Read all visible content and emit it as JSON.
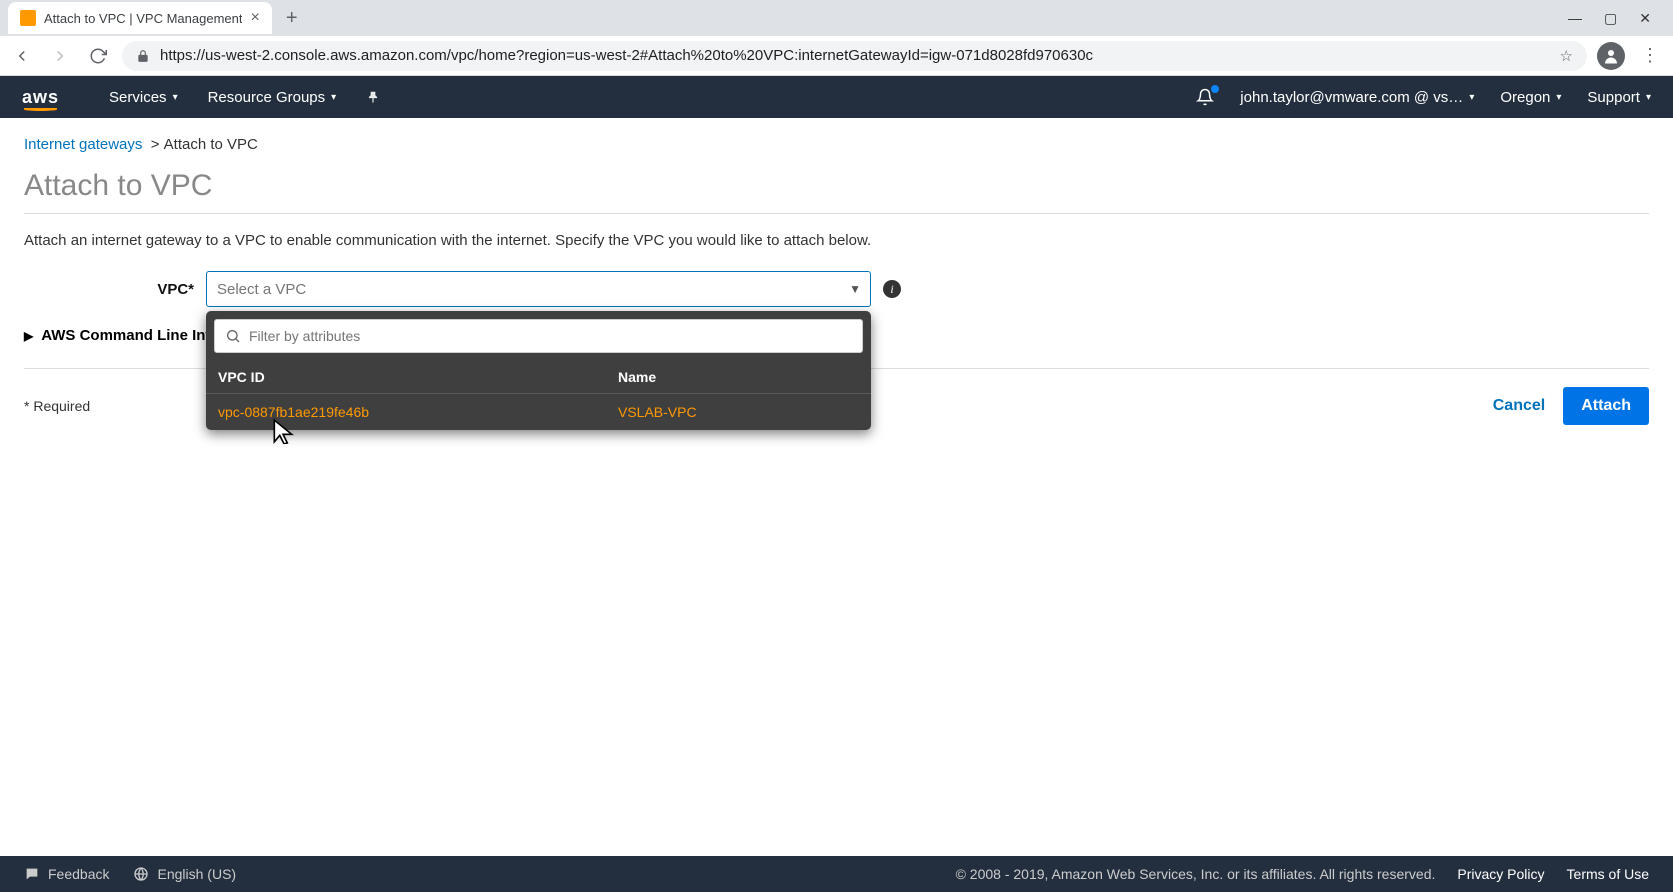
{
  "browser": {
    "tab_title": "Attach to VPC | VPC Management",
    "url": "https://us-west-2.console.aws.amazon.com/vpc/home?region=us-west-2#Attach%20to%20VPC:internetGatewayId=igw-071d8028fd970630c"
  },
  "awsnav": {
    "logo": "aws",
    "services": "Services",
    "resource_groups": "Resource Groups",
    "user": "john.taylor@vmware.com @ vs…",
    "region": "Oregon",
    "support": "Support"
  },
  "breadcrumb": {
    "root": "Internet gateways",
    "current": "Attach to VPC"
  },
  "page": {
    "title": "Attach to VPC",
    "description": "Attach an internet gateway to a VPC to enable communication with the internet. Specify the VPC you would like to attach below.",
    "vpc_label": "VPC*",
    "vpc_placeholder": "Select a VPC",
    "cli_toggle": "AWS Command Line Interface command",
    "required_note": "* Required",
    "cancel": "Cancel",
    "attach": "Attach"
  },
  "dropdown": {
    "filter_placeholder": "Filter by attributes",
    "header_id": "VPC ID",
    "header_name": "Name",
    "row": {
      "id": "vpc-0887fb1ae219fe46b",
      "name": "VSLAB-VPC"
    }
  },
  "footer": {
    "feedback": "Feedback",
    "language": "English (US)",
    "copyright": "© 2008 - 2019, Amazon Web Services, Inc. or its affiliates. All rights reserved.",
    "privacy": "Privacy Policy",
    "terms": "Terms of Use"
  }
}
